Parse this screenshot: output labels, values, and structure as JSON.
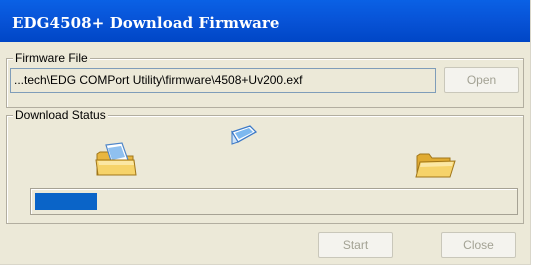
{
  "window": {
    "title": "EDG4508+ Download Firmware"
  },
  "firmware_file": {
    "group_label": "Firmware File",
    "path": "...tech\\EDG COMPort Utility\\firmware\\4508+Uv200.exf",
    "open_label": "Open"
  },
  "download_status": {
    "group_label": "Download Status",
    "icons": {
      "source": "folder-with-document-icon",
      "transfer": "flying-document-icon",
      "destination": "open-folder-icon"
    },
    "progress_fraction": 0.13,
    "progress_color": "#0a64c8"
  },
  "buttons": {
    "start_label": "Start",
    "close_label": "Close"
  },
  "colors": {
    "titlebar": "#0854d8",
    "face": "#ece9d8",
    "disabled_text": "#a3a294"
  }
}
